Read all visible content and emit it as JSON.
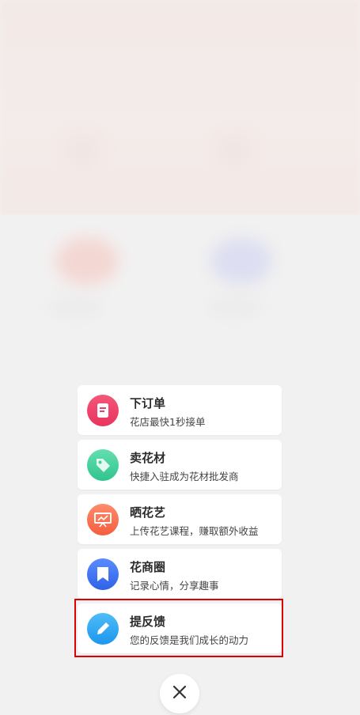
{
  "menu": {
    "items": [
      {
        "title": "下订单",
        "subtitle": "花店最快1秒接单",
        "icon": "order-doc-icon",
        "color": "#ef3f6a"
      },
      {
        "title": "卖花材",
        "subtitle": "快捷入驻成为花材批发商",
        "icon": "tag-icon",
        "color": "#3dcf9c"
      },
      {
        "title": "晒花艺",
        "subtitle": "上传花艺课程，赚取额外收益",
        "icon": "presentation-icon",
        "color": "#f86a4a"
      },
      {
        "title": "花商圈",
        "subtitle": "记录心情，分享趣事",
        "icon": "bookmark-icon",
        "color": "#3a72f2"
      },
      {
        "title": "提反馈",
        "subtitle": "您的反馈是我们成长的动力",
        "icon": "pen-icon",
        "color": "#2aa7f2"
      }
    ]
  },
  "close_icon": "close-icon"
}
